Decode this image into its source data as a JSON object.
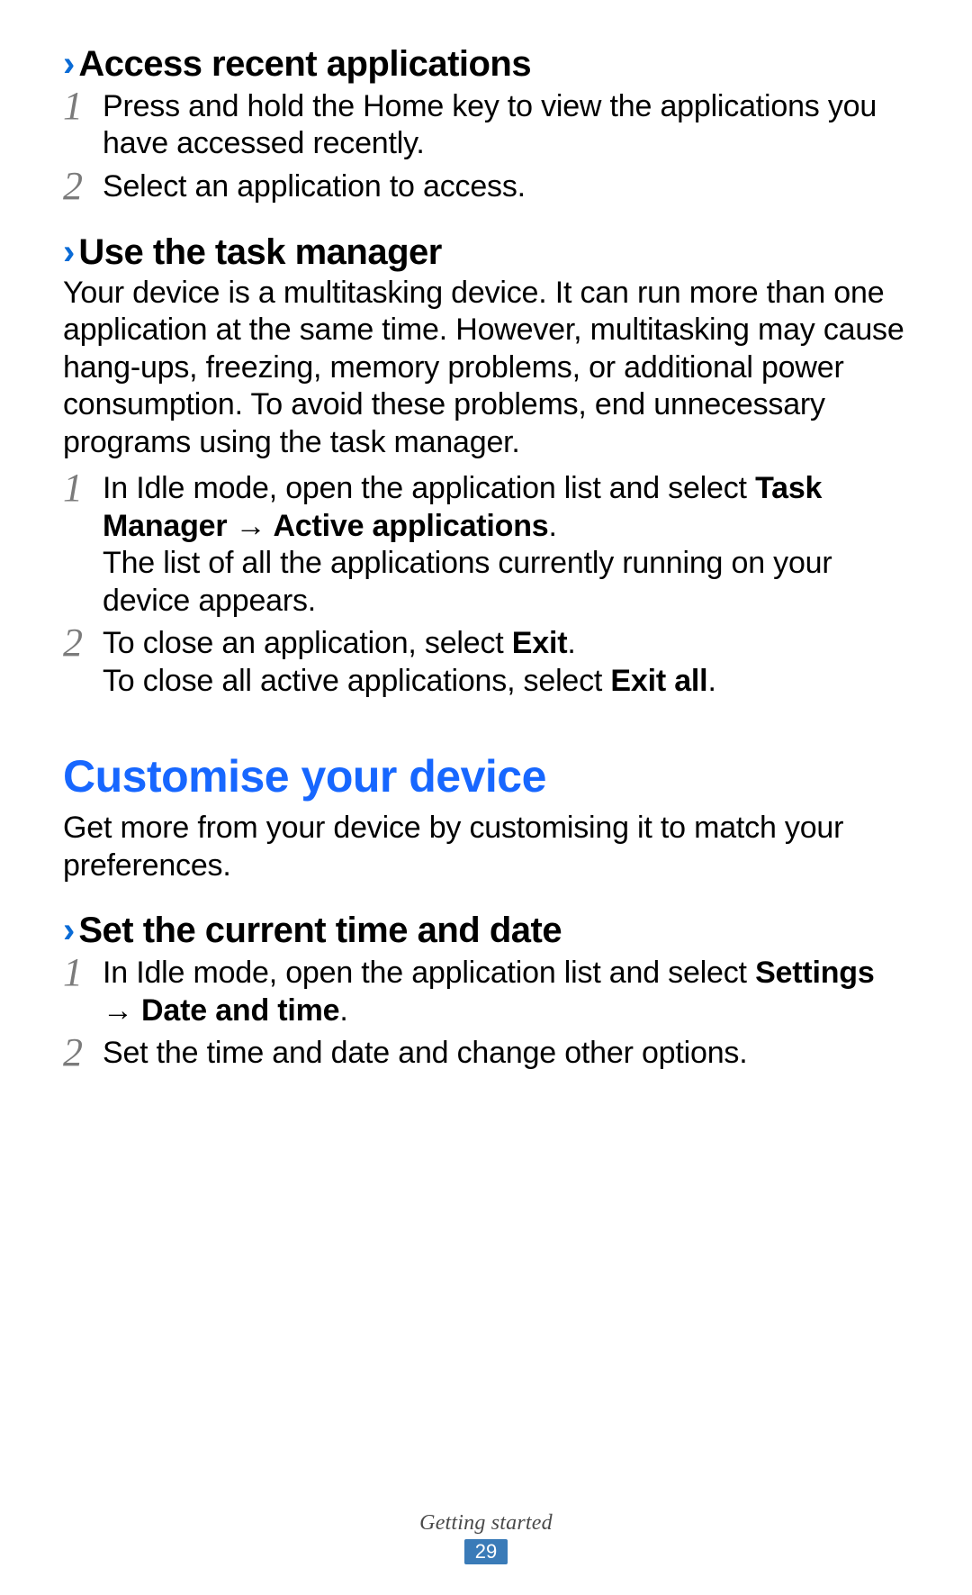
{
  "chevron": "›",
  "section1": {
    "heading": "Access recent applications",
    "steps": [
      {
        "num": "1",
        "text": "Press and hold the Home key to view the applications you have accessed recently."
      },
      {
        "num": "2",
        "text": "Select an application to access."
      }
    ]
  },
  "section2": {
    "heading": "Use the task manager",
    "intro": "Your device is a multitasking device. It can run more than one application at the same time. However, multitasking may cause hang-ups, freezing, memory problems, or additional power consumption. To avoid these problems, end unnecessary programs using the task manager.",
    "step1": {
      "num": "1",
      "pre": "In Idle mode, open the application list and select ",
      "bold1": "Task Manager",
      "arrow": " → ",
      "bold2": "Active applications",
      "period": ".",
      "after": "The list of all the applications currently running on your device appears."
    },
    "step2": {
      "num": "2",
      "pre1": "To close an application, select ",
      "bold1": "Exit",
      "period1": ".",
      "pre2": "To close all active applications, select ",
      "bold2": "Exit all",
      "period2": "."
    }
  },
  "mainHeading": "Customise your device",
  "mainIntro": "Get more from your device by customising it to match your preferences.",
  "section3": {
    "heading": "Set the current time and date",
    "step1": {
      "num": "1",
      "pre": "In Idle mode, open the application list and select ",
      "bold1": "Settings",
      "arrow": " → ",
      "bold2": "Date and time",
      "period": "."
    },
    "step2": {
      "num": "2",
      "text": "Set the time and date and change other options."
    }
  },
  "footer": {
    "label": "Getting started",
    "page": "29"
  }
}
